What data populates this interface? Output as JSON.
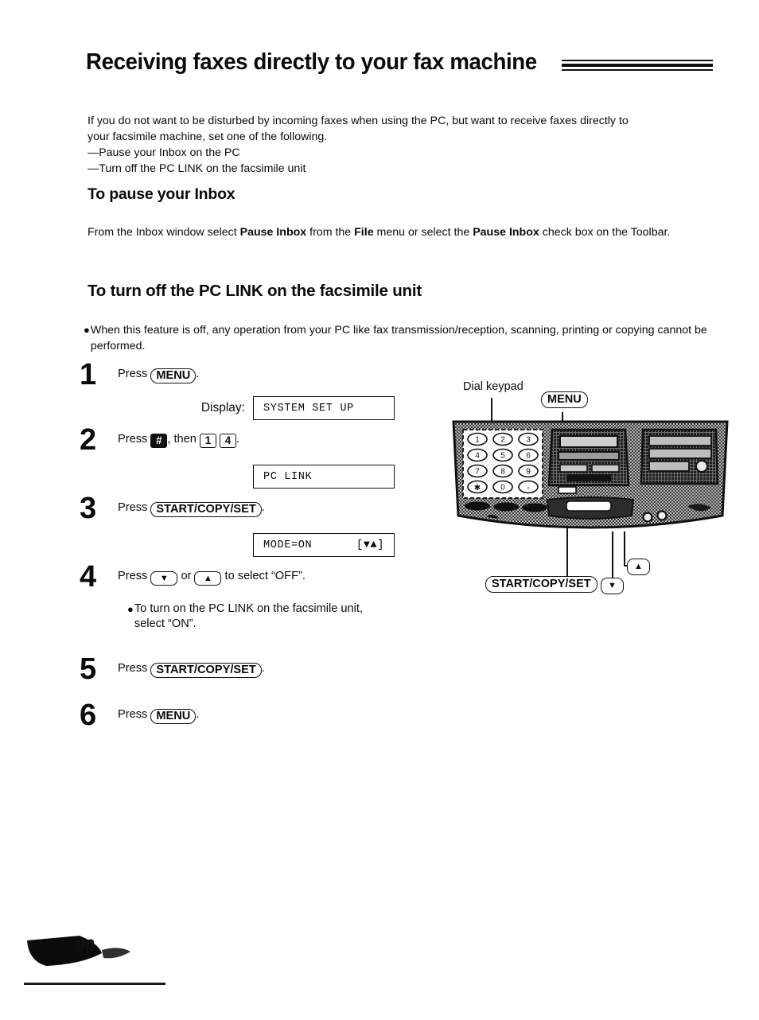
{
  "header": {
    "title": "Receiving faxes directly to your fax machine"
  },
  "intro": {
    "line1": "If you do not want to be disturbed by incoming faxes when using the PC, but want to receive faxes directly to",
    "line2": "your facsimile machine, set one of the following.",
    "item1": "—Pause your Inbox on the PC",
    "item2": "—Turn off the PC LINK on the facsimile unit"
  },
  "section_pause": {
    "heading": "To pause your Inbox",
    "text_1": "From the Inbox window select ",
    "bold_1": "Pause Inbox",
    "text_2": " from the ",
    "bold_2": "File",
    "text_3": " menu or select the ",
    "bold_3": "Pause Inbox",
    "text_4": " check box on the Toolbar."
  },
  "section_pclink": {
    "heading": "To turn off the PC LINK on the facsimile unit",
    "bullet": "When this feature is off, any operation from your PC like fax transmission/reception, scanning, printing or copying cannot be performed."
  },
  "steps": [
    {
      "number": "1",
      "press_label": "Press",
      "key": "MENU",
      "period": ".",
      "display_label": "Display:",
      "display_text": "SYSTEM SET UP",
      "display_right": ""
    },
    {
      "number": "2",
      "press_label": "Press",
      "key_hash": "#",
      "then_label": ", then",
      "key_1": "1",
      "key_4": "4",
      "period": ".",
      "display_text": "PC LINK",
      "display_right": ""
    },
    {
      "number": "3",
      "press_label": "Press",
      "key": "START/COPY/SET",
      "period": ".",
      "display_text": "MODE=ON",
      "display_right": "[▼▲]"
    },
    {
      "number": "4",
      "press_label": "Press",
      "key_down": "▼",
      "or_label": "or",
      "key_up": "▲",
      "tail_label": "to select “OFF”.",
      "note_line1": "To turn on the PC LINK on the facsimile unit,",
      "note_line2": "select “ON”."
    },
    {
      "number": "5",
      "press_label": "Press",
      "key": "START/COPY/SET",
      "period": "."
    },
    {
      "number": "6",
      "press_label": "Press",
      "key": "MENU",
      "period": "."
    }
  ],
  "diagram": {
    "label_keypad": "Dial keypad",
    "callout_menu": "MENU",
    "callout_start": "START/COPY/SET",
    "callout_up": "▲",
    "callout_down": "▼",
    "keypad_keys": [
      "1",
      "2",
      "3",
      "4",
      "5",
      "6",
      "7",
      "8",
      "9",
      "✱",
      "0",
      "⌗"
    ]
  },
  "footer": {
    "page_number": "90"
  },
  "colors": {
    "ink": "#0a0a0a",
    "panel_gray": "#9a9a9a",
    "panel_dark": "#2b2b2b"
  }
}
